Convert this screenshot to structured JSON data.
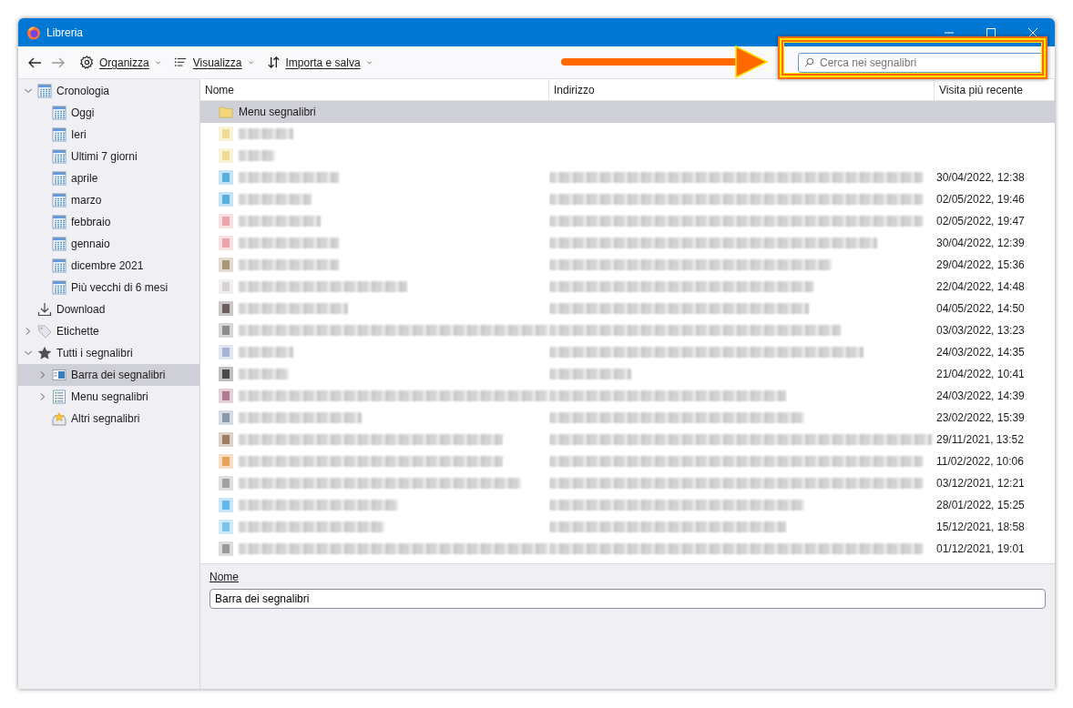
{
  "window": {
    "title": "Libreria"
  },
  "toolbar": {
    "menus": [
      {
        "label": "Organizza"
      },
      {
        "label": "Visualizza"
      },
      {
        "label": "Importa e salva"
      }
    ],
    "search": {
      "placeholder": "Cerca nei segnalibri"
    }
  },
  "sidebar": {
    "items": [
      {
        "label": "Cronologia",
        "kind": "history",
        "expanded": true,
        "selected": false,
        "children": [
          {
            "label": "Oggi",
            "kind": "history",
            "selected": false
          },
          {
            "label": "Ieri",
            "kind": "history",
            "selected": false
          },
          {
            "label": "Ultimi 7 giorni",
            "kind": "history",
            "selected": false
          },
          {
            "label": "aprile",
            "kind": "history",
            "selected": false
          },
          {
            "label": "marzo",
            "kind": "history",
            "selected": false
          },
          {
            "label": "febbraio",
            "kind": "history",
            "selected": false
          },
          {
            "label": "gennaio",
            "kind": "history",
            "selected": false
          },
          {
            "label": "dicembre 2021",
            "kind": "history",
            "selected": false
          },
          {
            "label": "Più vecchi di 6 mesi",
            "kind": "history",
            "selected": false
          }
        ]
      },
      {
        "label": "Download",
        "kind": "downloads",
        "selected": false
      },
      {
        "label": "Etichette",
        "kind": "tags",
        "expanded": false,
        "selected": false
      },
      {
        "label": "Tutti i segnalibri",
        "kind": "all",
        "expanded": true,
        "selected": false,
        "children": [
          {
            "label": "Barra dei segnalibri",
            "kind": "toolbar",
            "expanded": false,
            "selected": true
          },
          {
            "label": "Menu segnalibri",
            "kind": "menu",
            "expanded": false,
            "selected": false
          },
          {
            "label": "Altri segnalibri",
            "kind": "other",
            "selected": false
          }
        ]
      }
    ]
  },
  "table": {
    "columns": [
      "Nome",
      "Indirizzo",
      "Visita più recente"
    ],
    "rows": [
      {
        "kind": "folder",
        "name": "Menu segnalibri",
        "selected": true,
        "color": "#f3d57a"
      },
      {
        "kind": "blurred-folder",
        "selected": false,
        "color": "#eedc96"
      },
      {
        "kind": "blurred-folder",
        "selected": false,
        "color": "#eedc96"
      },
      {
        "kind": "bookmark",
        "visited": "30/04/2022, 12:38",
        "selected": false,
        "color": "#5aaee0"
      },
      {
        "kind": "bookmark",
        "visited": "02/05/2022, 19:46",
        "selected": false,
        "color": "#5aaee0"
      },
      {
        "kind": "bookmark",
        "visited": "02/05/2022, 19:47",
        "selected": false,
        "color": "#eba5ae"
      },
      {
        "kind": "bookmark",
        "visited": "30/04/2022, 12:39",
        "selected": false,
        "color": "#eba5ae"
      },
      {
        "kind": "bookmark",
        "visited": "29/04/2022, 15:36",
        "selected": false,
        "color": "#a8977a"
      },
      {
        "kind": "bookmark",
        "visited": "22/04/2022, 14:48",
        "selected": false,
        "color": "#d8d2d2"
      },
      {
        "kind": "bookmark",
        "visited": "04/05/2022, 14:50",
        "selected": false,
        "color": "#6e5f5f"
      },
      {
        "kind": "bookmark",
        "visited": "03/03/2022, 13:23",
        "selected": false,
        "color": "#8c8c8c"
      },
      {
        "kind": "bookmark",
        "visited": "24/03/2022, 14:35",
        "selected": false,
        "color": "#a5b4d2"
      },
      {
        "kind": "bookmark",
        "visited": "21/04/2022, 10:41",
        "selected": false,
        "color": "#4a4a4a"
      },
      {
        "kind": "bookmark",
        "visited": "24/03/2022, 14:39",
        "selected": false,
        "color": "#b07a91"
      },
      {
        "kind": "bookmark",
        "visited": "23/02/2022, 15:39",
        "selected": false,
        "color": "#8898aa"
      },
      {
        "kind": "bookmark",
        "visited": "29/11/2021, 13:52",
        "selected": false,
        "color": "#9a7c64"
      },
      {
        "kind": "bookmark",
        "visited": "11/02/2022, 10:06",
        "selected": false,
        "color": "#e8a25a"
      },
      {
        "kind": "bookmark",
        "visited": "03/12/2021, 12:21",
        "selected": false,
        "color": "#a0a0a0"
      },
      {
        "kind": "bookmark",
        "visited": "28/01/2022, 15:25",
        "selected": false,
        "color": "#62b6ea"
      },
      {
        "kind": "bookmark",
        "visited": "15/12/2021, 18:58",
        "selected": false,
        "color": "#7cc3ea"
      },
      {
        "kind": "bookmark",
        "visited": "01/12/2021, 19:01",
        "selected": false,
        "color": "#9a9a9a"
      }
    ]
  },
  "details": {
    "label": "Nome",
    "value": "Barra dei segnalibri"
  }
}
